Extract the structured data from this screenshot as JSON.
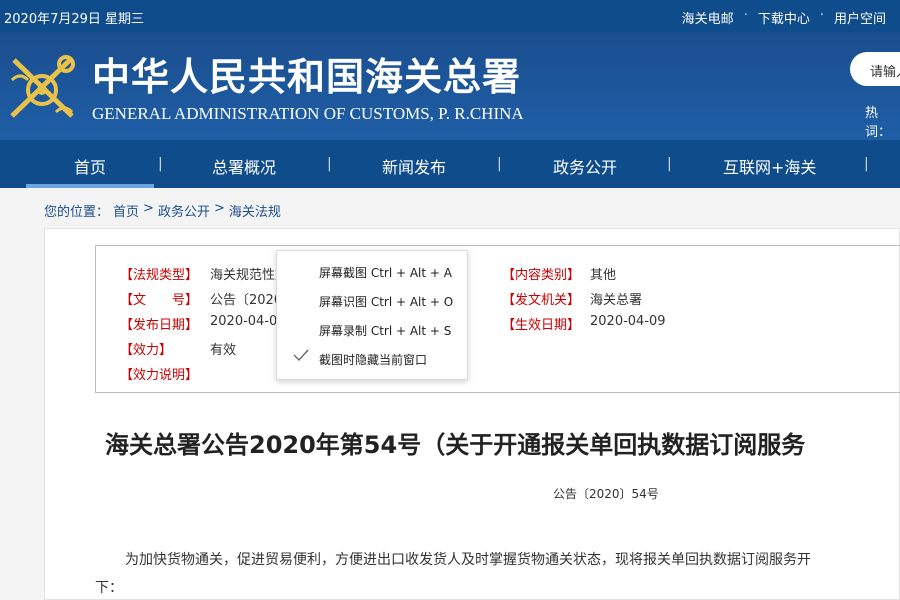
{
  "topbar": {
    "date": "2020年7月29日 星期三",
    "links": [
      "海关电邮",
      "下载中心",
      "用户空间"
    ]
  },
  "header": {
    "title_cn": "中华人民共和国海关总署",
    "title_en": "GENERAL ADMINISTRATION OF CUSTOMS, P. R.CHINA",
    "search_placeholder": "请输入",
    "hot_label": "热词："
  },
  "nav": {
    "items": [
      "首页",
      "总署概况",
      "新闻发布",
      "政务公开",
      "互联网+海关"
    ],
    "active_index": 0
  },
  "breadcrumb": {
    "prefix": "您的位置：",
    "items": [
      "首页",
      "政务公开",
      "海关法规"
    ],
    "separator": ">"
  },
  "meta": {
    "left": [
      {
        "key": "【法规类型】",
        "value": "海关规范性文件"
      },
      {
        "key": "【文　　号】",
        "value": "公告〔2020〕54号"
      },
      {
        "key": "【发布日期】",
        "value": "2020-04-09"
      },
      {
        "key": "【效力】",
        "value": "有效"
      },
      {
        "key": "【效力说明】",
        "value": ""
      }
    ],
    "right": [
      {
        "key": "【内容类别】",
        "value": "其他"
      },
      {
        "key": "【发文机关】",
        "value": "海关总署"
      },
      {
        "key": "【生效日期】",
        "value": "2020-04-09"
      }
    ]
  },
  "document": {
    "title": "海关总署公告2020年第54号（关于开通报关单回执数据订阅服务",
    "number": "公告〔2020〕54号",
    "paragraph": "为加快货物通关，促进贸易便利，方便进出口收发货人及时掌握货物通关状态，现将报关单回执数据订阅服务开",
    "paragraph_cont": "下："
  },
  "context_menu": {
    "items": [
      "屏幕截图 Ctrl + Alt + A",
      "屏幕识图 Ctrl + Alt + O",
      "屏幕录制 Ctrl + Alt + S",
      "截图时隐藏当前窗口"
    ],
    "checked_index": 3
  },
  "colors": {
    "brand_blue": "#0f4c8b",
    "meta_key_red": "#cc0000"
  }
}
